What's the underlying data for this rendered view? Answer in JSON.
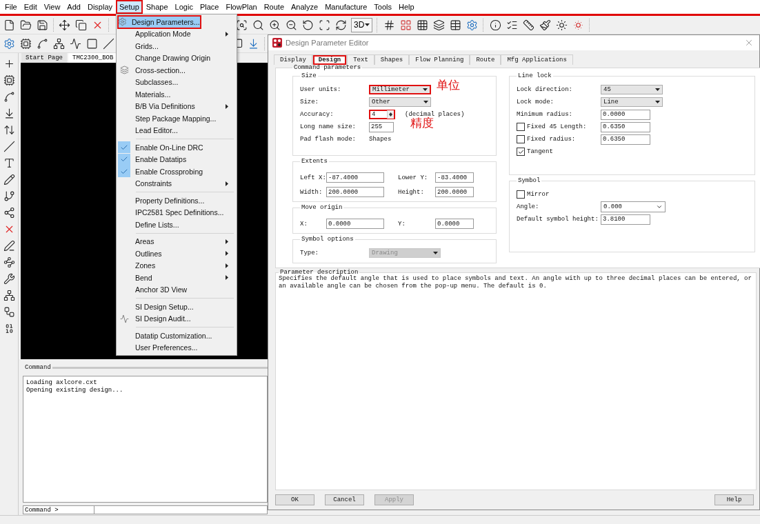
{
  "menubar": {
    "items": [
      {
        "label": "File",
        "selected": false,
        "annotated": false
      },
      {
        "label": "Edit",
        "selected": false,
        "annotated": false
      },
      {
        "label": "View",
        "selected": false,
        "annotated": false
      },
      {
        "label": "Add",
        "selected": false,
        "annotated": false
      },
      {
        "label": "Display",
        "selected": false,
        "annotated": false
      },
      {
        "label": "Setup",
        "selected": true,
        "annotated": true
      },
      {
        "label": "Shape",
        "selected": false,
        "annotated": false
      },
      {
        "label": "Logic",
        "selected": false,
        "annotated": false
      },
      {
        "label": "Place",
        "selected": false,
        "annotated": false
      },
      {
        "label": "FlowPlan",
        "selected": false,
        "annotated": false
      },
      {
        "label": "Route",
        "selected": false,
        "annotated": false
      },
      {
        "label": "Analyze",
        "selected": false,
        "annotated": false
      },
      {
        "label": "Manufacture",
        "selected": false,
        "annotated": false
      },
      {
        "label": "Tools",
        "selected": false,
        "annotated": false
      },
      {
        "label": "Help",
        "selected": false,
        "annotated": false
      }
    ]
  },
  "toolbar": {
    "view_3d_button": "3D"
  },
  "setup_menu": {
    "items": [
      {
        "kind": "item",
        "label": "Design Parameters...",
        "selected": true,
        "annotated": true,
        "checked": false,
        "submenu": false
      },
      {
        "kind": "item",
        "label": "Application Mode",
        "selected": false,
        "annotated": false,
        "checked": false,
        "submenu": true
      },
      {
        "kind": "item",
        "label": "Grids...",
        "selected": false,
        "annotated": false,
        "checked": false,
        "submenu": false
      },
      {
        "kind": "item",
        "label": "Change Drawing Origin",
        "selected": false,
        "annotated": false,
        "checked": false,
        "submenu": false
      },
      {
        "kind": "item",
        "label": "Cross-section...",
        "selected": false,
        "annotated": false,
        "checked": false,
        "submenu": false
      },
      {
        "kind": "item",
        "label": "Subclasses...",
        "selected": false,
        "annotated": false,
        "checked": false,
        "submenu": false
      },
      {
        "kind": "item",
        "label": "Materials...",
        "selected": false,
        "annotated": false,
        "checked": false,
        "submenu": false
      },
      {
        "kind": "item",
        "label": "B/B Via Definitions",
        "selected": false,
        "annotated": false,
        "checked": false,
        "submenu": true
      },
      {
        "kind": "item",
        "label": "Step Package Mapping...",
        "selected": false,
        "annotated": false,
        "checked": false,
        "submenu": false
      },
      {
        "kind": "item",
        "label": "Lead Editor...",
        "selected": false,
        "annotated": false,
        "checked": false,
        "submenu": false
      },
      {
        "kind": "separator"
      },
      {
        "kind": "item",
        "label": "Enable On-Line DRC",
        "selected": false,
        "annotated": false,
        "checked": true,
        "submenu": false
      },
      {
        "kind": "item",
        "label": "Enable Datatips",
        "selected": false,
        "annotated": false,
        "checked": true,
        "submenu": false
      },
      {
        "kind": "item",
        "label": "Enable Crossprobing",
        "selected": false,
        "annotated": false,
        "checked": true,
        "submenu": false
      },
      {
        "kind": "item",
        "label": "Constraints",
        "selected": false,
        "annotated": false,
        "checked": false,
        "submenu": true
      },
      {
        "kind": "separator"
      },
      {
        "kind": "item",
        "label": "Property Definitions...",
        "selected": false,
        "annotated": false,
        "checked": false,
        "submenu": false
      },
      {
        "kind": "item",
        "label": "IPC2581 Spec Definitions...",
        "selected": false,
        "annotated": false,
        "checked": false,
        "submenu": false
      },
      {
        "kind": "item",
        "label": "Define Lists...",
        "selected": false,
        "annotated": false,
        "checked": false,
        "submenu": false
      },
      {
        "kind": "separator"
      },
      {
        "kind": "item",
        "label": "Areas",
        "selected": false,
        "annotated": false,
        "checked": false,
        "submenu": true
      },
      {
        "kind": "item",
        "label": "Outlines",
        "selected": false,
        "annotated": false,
        "checked": false,
        "submenu": true
      },
      {
        "kind": "item",
        "label": "Zones",
        "selected": false,
        "annotated": false,
        "checked": false,
        "submenu": true
      },
      {
        "kind": "item",
        "label": "Bend",
        "selected": false,
        "annotated": false,
        "checked": false,
        "submenu": true
      },
      {
        "kind": "item",
        "label": "Anchor 3D View",
        "selected": false,
        "annotated": false,
        "checked": false,
        "submenu": false
      },
      {
        "kind": "separator"
      },
      {
        "kind": "item",
        "label": "SI Design Setup...",
        "selected": false,
        "annotated": false,
        "checked": false,
        "submenu": false
      },
      {
        "kind": "item",
        "label": "SI Design Audit...",
        "selected": false,
        "annotated": false,
        "checked": false,
        "submenu": false
      },
      {
        "kind": "separator"
      },
      {
        "kind": "item",
        "label": "Datatip Customization...",
        "selected": false,
        "annotated": false,
        "checked": false,
        "submenu": false
      },
      {
        "kind": "item",
        "label": "User Preferences...",
        "selected": false,
        "annotated": false,
        "checked": false,
        "submenu": false
      }
    ]
  },
  "document_tabs": [
    {
      "label": "Start Page",
      "selected": false
    },
    {
      "label": "TMC2300_BOB",
      "selected": true
    }
  ],
  "command_window": {
    "title": "Command",
    "lines": [
      "Loading axlcore.cxt",
      "Opening existing design..."
    ],
    "prompt": "Command >"
  },
  "dialog": {
    "title": "Design Parameter Editor",
    "tabs": [
      {
        "label": "Display",
        "selected": false,
        "annotated": false
      },
      {
        "label": "Design",
        "selected": true,
        "annotated": true
      },
      {
        "label": "Text",
        "selected": false,
        "annotated": false
      },
      {
        "label": "Shapes",
        "selected": false,
        "annotated": false
      },
      {
        "label": "Flow Planning",
        "selected": false,
        "annotated": false
      },
      {
        "label": "Route",
        "selected": false,
        "annotated": false
      },
      {
        "label": "Mfg Applications",
        "selected": false,
        "annotated": false
      }
    ],
    "section_title": "Command parameters",
    "left_groups": [
      {
        "title": "Size",
        "kind": "form",
        "fields": [
          {
            "kind": "select",
            "label": "User units:",
            "value": "Millimeter",
            "annotated": true,
            "note": "单位"
          },
          {
            "kind": "select",
            "label": "Size:",
            "value": "Other",
            "annotated": false
          },
          {
            "kind": "spinner",
            "label": "Accuracy:",
            "value": "4",
            "suffix": "(decimal places)",
            "annotated": true,
            "note": "精度"
          },
          {
            "kind": "input",
            "label": "Long name size:",
            "value": "255",
            "annotated": false
          },
          {
            "kind": "static",
            "label": "Pad flash mode:",
            "value": "Shapes",
            "annotated": false
          }
        ]
      },
      {
        "title": "Extents",
        "kind": "pairs",
        "fields": [
          {
            "kind": "input",
            "label": "Left X:",
            "value": "-87.4000"
          },
          {
            "kind": "input",
            "label": "Lower Y:",
            "value": "-83.4000"
          },
          {
            "kind": "input",
            "label": "Width:",
            "value": "200.0000"
          },
          {
            "kind": "input",
            "label": "Height:",
            "value": "200.0000"
          }
        ]
      },
      {
        "title": "Move origin",
        "kind": "pairs",
        "fields": [
          {
            "kind": "input",
            "label": "X:",
            "value": "0.0000"
          },
          {
            "kind": "input",
            "label": "Y:",
            "value": "0.0000"
          }
        ]
      },
      {
        "title": "Symbol options",
        "kind": "form",
        "fields": [
          {
            "kind": "select",
            "label": "Type:",
            "value": "Drawing",
            "disabled": true
          }
        ]
      }
    ],
    "right_groups": [
      {
        "title": "Line lock",
        "kind": "form",
        "fields": [
          {
            "kind": "select",
            "label": "Lock direction:",
            "value": "45"
          },
          {
            "kind": "select",
            "label": "Lock mode:",
            "value": "Line"
          },
          {
            "kind": "input",
            "label": "Minimum radius:",
            "value": "0.0000"
          },
          {
            "kind": "checkbox",
            "label": "Fixed 45 Length:",
            "checked": false,
            "value": "0.6350"
          },
          {
            "kind": "checkbox",
            "label": "Fixed radius:",
            "checked": false,
            "value": "0.6350"
          },
          {
            "kind": "checkbox",
            "label": "Tangent",
            "checked": true
          }
        ]
      },
      {
        "title": "Symbol",
        "kind": "form",
        "fields": [
          {
            "kind": "checkbox",
            "label": "Mirror",
            "checked": false
          },
          {
            "kind": "combo",
            "label": "Angle:",
            "value": "0.000"
          },
          {
            "kind": "input",
            "label": "Default symbol height:",
            "value": "3.8100"
          }
        ]
      }
    ],
    "description": {
      "title": "Parameter description",
      "text": "Specifies the default angle that is used to place symbols and text. An angle with up to three decimal places can be entered, or an available angle can be chosen from the pop-up menu. The default is 0."
    },
    "buttons": [
      {
        "label": "OK",
        "disabled": false
      },
      {
        "label": "Cancel",
        "disabled": false
      },
      {
        "label": "Apply",
        "disabled": true
      }
    ],
    "help_button": "Help"
  }
}
